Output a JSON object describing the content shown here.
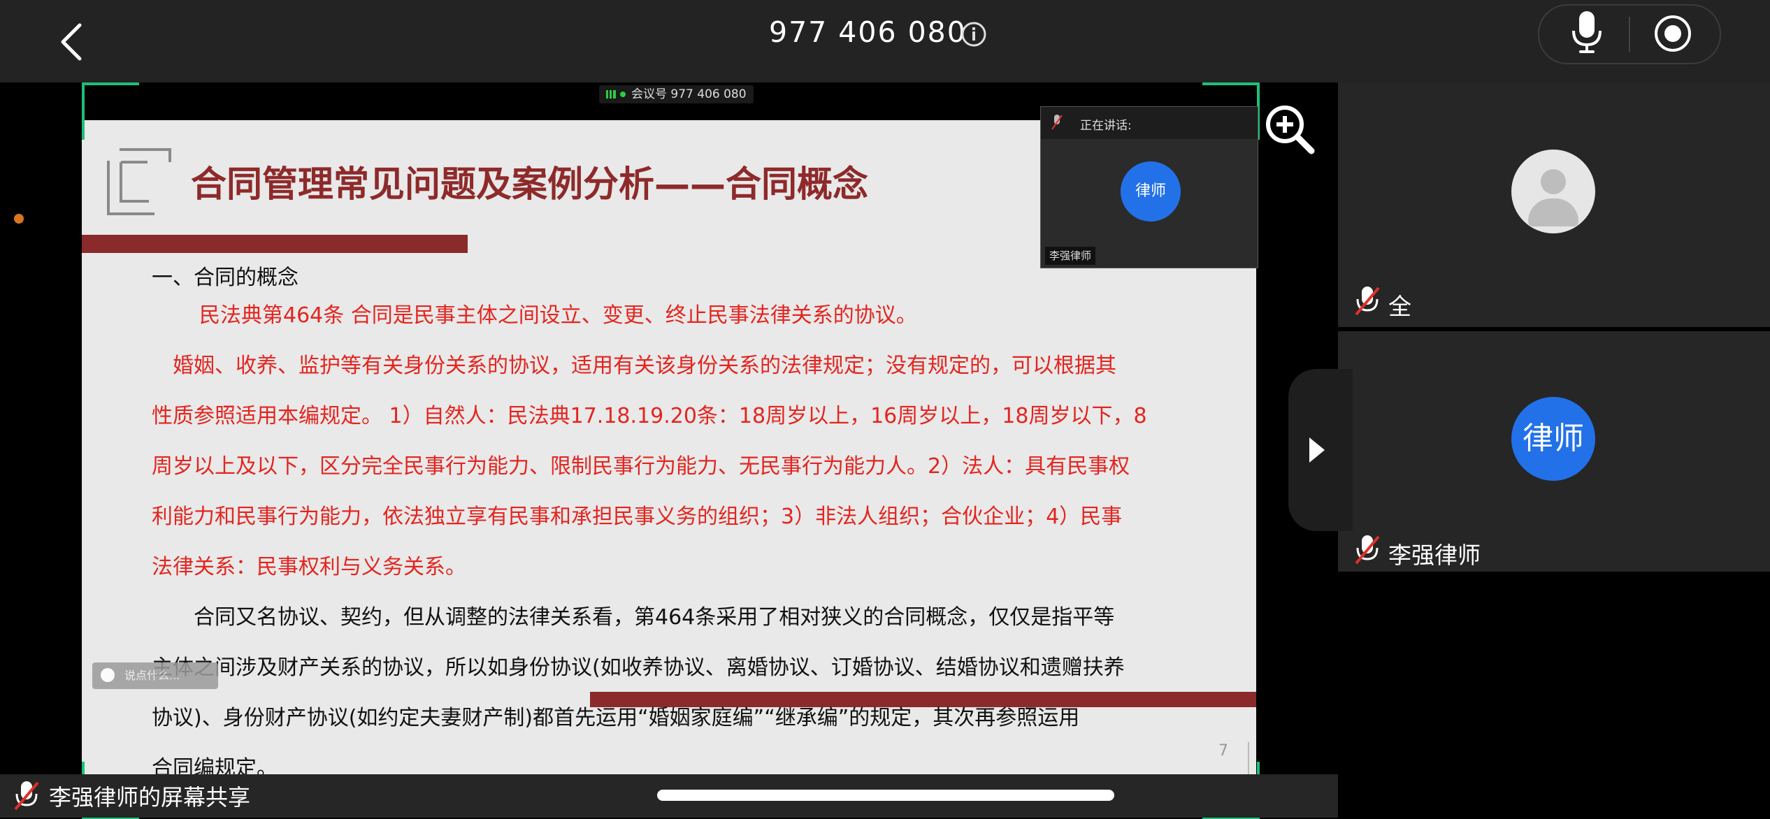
{
  "topbar": {
    "meeting_id": "977 406 080",
    "icons": [
      "back-chevron-icon",
      "info-icon",
      "microphone-icon",
      "record-icon"
    ]
  },
  "shared_screen": {
    "meeting_tag": "会议号 977 406 080",
    "slide": {
      "title": "合同管理常见问题及案例分析——合同概念",
      "heading": "一、合同的概念",
      "red_lines": [
        "　民法典第464条  合同是民事主体之间设立、变更、终止民事法律关系的协议。",
        "　婚姻、收养、监护等有关身份关系的协议，适用有关该身份关系的法律规定；没有规定的，可以根据其",
        "性质参照适用本编规定。 1）自然人：民法典17.18.19.20条：18周岁以上，16周岁以上，18周岁以下，8",
        "周岁以上及以下，区分完全民事行为能力、限制民事行为能力、无民事行为能力人。2）法人：具有民事权",
        "利能力和民事行为能力，依法独立享有民事和承担民事义务的组织；3）非法人组织；合伙企业；4）民事",
        "法律关系：民事权利与义务关系。"
      ],
      "black_lines": [
        "　　合同又名协议、契约，但从调整的法律关系看，第464条采用了相对狭义的合同概念，仅仅是指平等",
        "主体之间涉及财产关系的协议，所以如身份协议(如收养协议、离婚协议、订婚协议、结婚协议和遗赠扶养",
        "协议)、身份财产协议(如约定夫妻财产制)都首先运用“婚姻家庭编”“继承编”的规定，其次再参照运用",
        "合同编规定。"
      ],
      "page_number": "7"
    },
    "say_something": "说点什么...",
    "speaker_panel": {
      "label": "正在讲话:",
      "avatar_text": "律师",
      "name": "李强律师"
    }
  },
  "participants": [
    {
      "name": "全",
      "muted": true,
      "avatar": "default-user-icon"
    },
    {
      "name": "李强律师",
      "muted": true,
      "avatar_text": "律师"
    }
  ],
  "status_bar": {
    "text": "李强律师的屏幕共享"
  },
  "colors": {
    "accent_blue": "#2271e8",
    "slide_red": "#e3251f",
    "title_red": "#8e2a2a",
    "frame_green": "#1fbf7a",
    "mute_red": "#e0302a"
  }
}
